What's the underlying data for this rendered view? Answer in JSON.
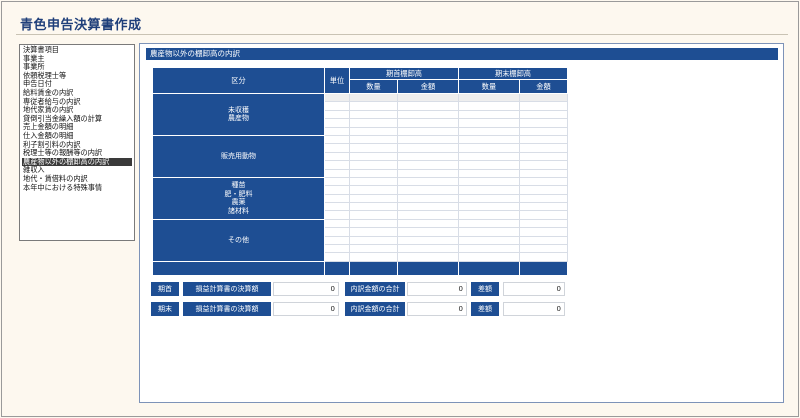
{
  "app": {
    "title": "青色申告決算書作成"
  },
  "sidebar": {
    "items": [
      {
        "label": "決算書項目"
      },
      {
        "label": "事業主"
      },
      {
        "label": "事業所"
      },
      {
        "label": "依頼税理士等"
      },
      {
        "label": "申告日付"
      },
      {
        "label": "給料賃金の内訳"
      },
      {
        "label": "専従者給与の内訳"
      },
      {
        "label": "地代家賃の内訳"
      },
      {
        "label": "貸倒引当金繰入額の計算"
      },
      {
        "label": "売上金額の明細"
      },
      {
        "label": "仕入金額の明細"
      },
      {
        "label": "利子割引料の内訳"
      },
      {
        "label": "税理士等の報酬等の内訳"
      },
      {
        "label": "農産物以外の棚卸高の内訳",
        "active": true
      },
      {
        "label": "雑収入"
      },
      {
        "label": "地代・賃借料の内訳"
      },
      {
        "label": "本年中における特殊事情"
      }
    ]
  },
  "panel": {
    "title": "農産物以外の棚卸高の内訳",
    "table": {
      "col_category": "区分",
      "col_unit": "単位",
      "col_opening": "期首棚卸高",
      "col_closing": "期末棚卸高",
      "col_qty": "数量",
      "col_amount": "金額",
      "categories": [
        {
          "label": "未収穫\n農産物"
        },
        {
          "label": "販売用動物"
        },
        {
          "label": "種苗\n肥・肥料\n農薬\n諸材料"
        },
        {
          "label": "その他"
        }
      ]
    },
    "summary": {
      "opening": {
        "period": "期首",
        "pl_label": "損益計算書の決算額",
        "pl_value": "0",
        "breakdown_label": "内訳金額の合計",
        "breakdown_value": "0",
        "diff_label": "差額",
        "diff_value": "0"
      },
      "closing": {
        "period": "期末",
        "pl_label": "損益計算書の決算額",
        "pl_value": "0",
        "breakdown_label": "内訳金額の合計",
        "breakdown_value": "0",
        "diff_label": "差額",
        "diff_value": "0"
      }
    }
  }
}
